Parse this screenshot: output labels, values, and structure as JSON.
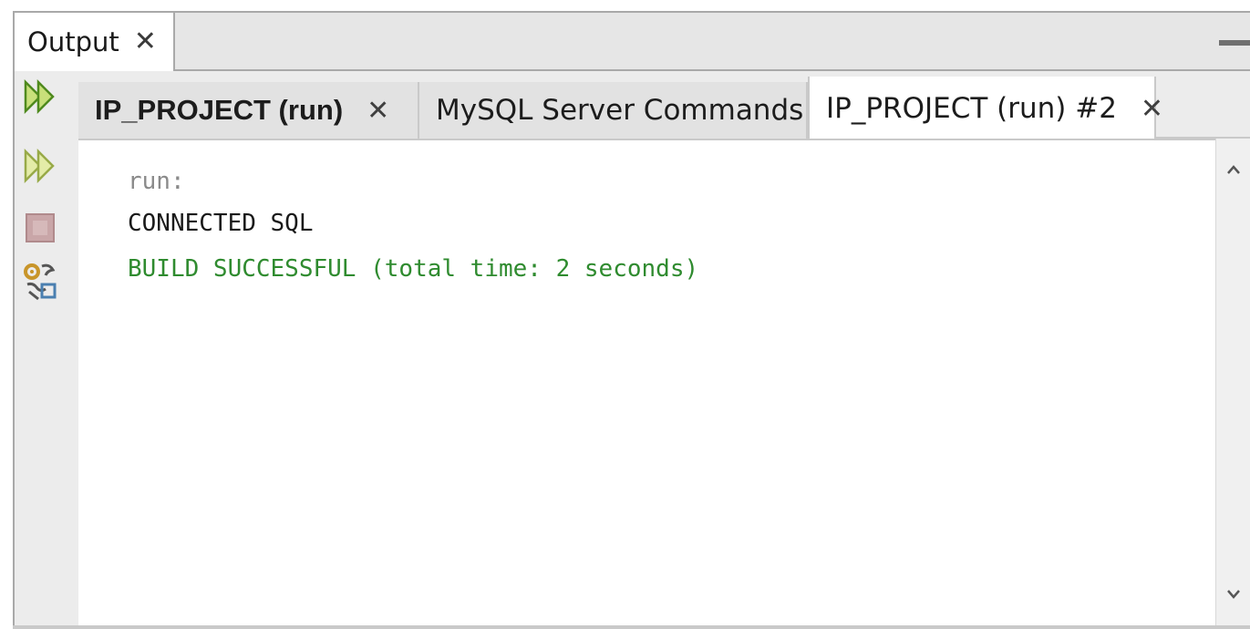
{
  "panel": {
    "title": "Output",
    "close_glyph": "✕"
  },
  "tabs": [
    {
      "label": "IP_PROJECT (run)",
      "close_glyph": "✕",
      "bold": true,
      "active": false
    },
    {
      "label": "MySQL Server Commands",
      "close_glyph": "✕",
      "bold": false,
      "active": false
    },
    {
      "label": "IP_PROJECT (run) #2",
      "close_glyph": "✕",
      "bold": false,
      "active": true
    }
  ],
  "toolbar": {
    "icons": [
      "rerun-icon",
      "rerun-with-options-icon",
      "stop-icon",
      "settings-icon"
    ]
  },
  "output": {
    "lines": [
      {
        "text": "run:",
        "color": "#8a8a8a"
      },
      {
        "text": "CONNECTED SQL",
        "color": "#1a1a1a"
      },
      {
        "text": "BUILD SUCCESSFUL (total time: 2 seconds)",
        "color": "#2f8b2f"
      }
    ]
  },
  "scrollbar": {
    "up_glyph": "⌃",
    "down_glyph": "⌄"
  }
}
